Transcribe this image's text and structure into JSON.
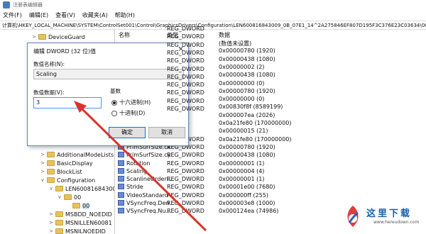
{
  "window": {
    "title": "注册表编辑器"
  },
  "menu": [
    "文件(F)",
    "编辑(E)",
    "查看(V)",
    "收藏夹(A)",
    "帮助(H)"
  ],
  "address": "计算机\\HKEY_LOCAL_MACHINE\\SYSTEM\\ControlSet001\\Control\\GraphicsDrivers\\Configuration\\LEN600816843009_0B_07E1_14^2A275846EF807D195F3C376E23C03634\\00\\00",
  "tree": [
    {
      "label": "DeviceGuard",
      "indent": 3,
      "exp": ">"
    },
    {
      "label": "AdditionalModeLists",
      "indent": 4,
      "exp": ">"
    },
    {
      "label": "BasicDisplay",
      "indent": 4,
      "exp": ">"
    },
    {
      "label": "BlockList",
      "indent": 4,
      "exp": ">"
    },
    {
      "label": "Configuration",
      "indent": 4,
      "exp": "v"
    },
    {
      "label": "LEN60081684300",
      "indent": 5,
      "exp": "v"
    },
    {
      "label": "00",
      "indent": 6,
      "exp": "v"
    },
    {
      "label": "00",
      "indent": 7,
      "exp": "",
      "selected": true
    },
    {
      "label": "MSBDD_NOEDID",
      "indent": 5,
      "exp": ">"
    },
    {
      "label": "MSNILLEN60081",
      "indent": 5,
      "exp": ">"
    },
    {
      "label": "MSNILNOEDID_",
      "indent": 5,
      "exp": ">"
    }
  ],
  "list": {
    "headers": {
      "name": "名称",
      "type": "类型",
      "data": "数据"
    },
    "rows": [
      {
        "name": "",
        "type": "",
        "data": "(数值未设置)"
      },
      {
        "name": "",
        "type": "",
        "data": "0x00000780 (1920)"
      },
      {
        "name": "",
        "type": "",
        "data": "0x00000438 (1080)"
      },
      {
        "name": "",
        "type": "",
        "data": "0x00000002 (2)"
      },
      {
        "name": "",
        "type": "",
        "data": "0x00000438 (1080)"
      },
      {
        "name": "",
        "type": "",
        "data": "0x00000000 (0)"
      },
      {
        "name": "",
        "type": "",
        "data": "0x00000780 (1920)"
      },
      {
        "name": "",
        "type": "",
        "data": "0x00000000 (0)"
      },
      {
        "name": "",
        "type": "",
        "data": "0x00830f8f (8589199)"
      },
      {
        "name": "",
        "type": "",
        "data": "0x000007ea (2026)"
      },
      {
        "name": "",
        "type": "",
        "data": "0x0a21fe80 (170000000)"
      },
      {
        "name": "",
        "type": "",
        "data": "0x00000015 (21)"
      },
      {
        "name": "PixelRate",
        "type": "REG_DWORD",
        "data": "0x0a21fe80 (170000000)"
      },
      {
        "name": "PrimSurfSize.cx",
        "type": "REG_DWORD",
        "data": "0x00000780 (1920)"
      },
      {
        "name": "PrimSurfSize.cy",
        "type": "REG_DWORD",
        "data": "0x00000438 (1080)"
      },
      {
        "name": "Rotation",
        "type": "REG_DWORD",
        "data": "0x00000001 (1)"
      },
      {
        "name": "Scaling",
        "type": "REG_DWORD",
        "data": "0x00000004 (4)"
      },
      {
        "name": "ScanlineOrderi...",
        "type": "REG_DWORD",
        "data": "0x00000001 (1)"
      },
      {
        "name": "Stride",
        "type": "REG_DWORD",
        "data": "0x00001e00 (7680)"
      },
      {
        "name": "VideoStandard",
        "type": "REG_DWORD",
        "data": "0x000000ff (255)"
      },
      {
        "name": "VSyncFreq.Den...",
        "type": "REG_DWORD",
        "data": "0x000003e8 (1000)"
      },
      {
        "name": "VSyncFreq.Nu...",
        "type": "REG_DWORD",
        "data": "0x000124ea (74986)"
      }
    ]
  },
  "partial_types": [
    "REG_DWORD",
    "REG_DWORD",
    "REG_DWORD",
    "REG_DWORD",
    "REG_DWORD",
    "REG_DWORD",
    "REG_DWORD",
    "REG_DWORD",
    "REG_DWORD",
    "REG_DWORD",
    "REG_DWORD"
  ],
  "dialog": {
    "title": "编辑 DWORD (32 位)值",
    "close": "×",
    "name_label": "数值名称(N):",
    "name_value": "Scaling",
    "data_label": "数值数据(V):",
    "data_value": "3",
    "base_label": "基数",
    "radio_hex": "十六进制(H)",
    "radio_dec": "十进制(D)",
    "ok": "确定",
    "cancel": "取消"
  },
  "watermark": {
    "text": "这里下载",
    "url": "www.hereudown.com"
  },
  "colors": {
    "arrow": "#d9342b",
    "selection": "#cce4f7",
    "accent": "#0078d7"
  }
}
